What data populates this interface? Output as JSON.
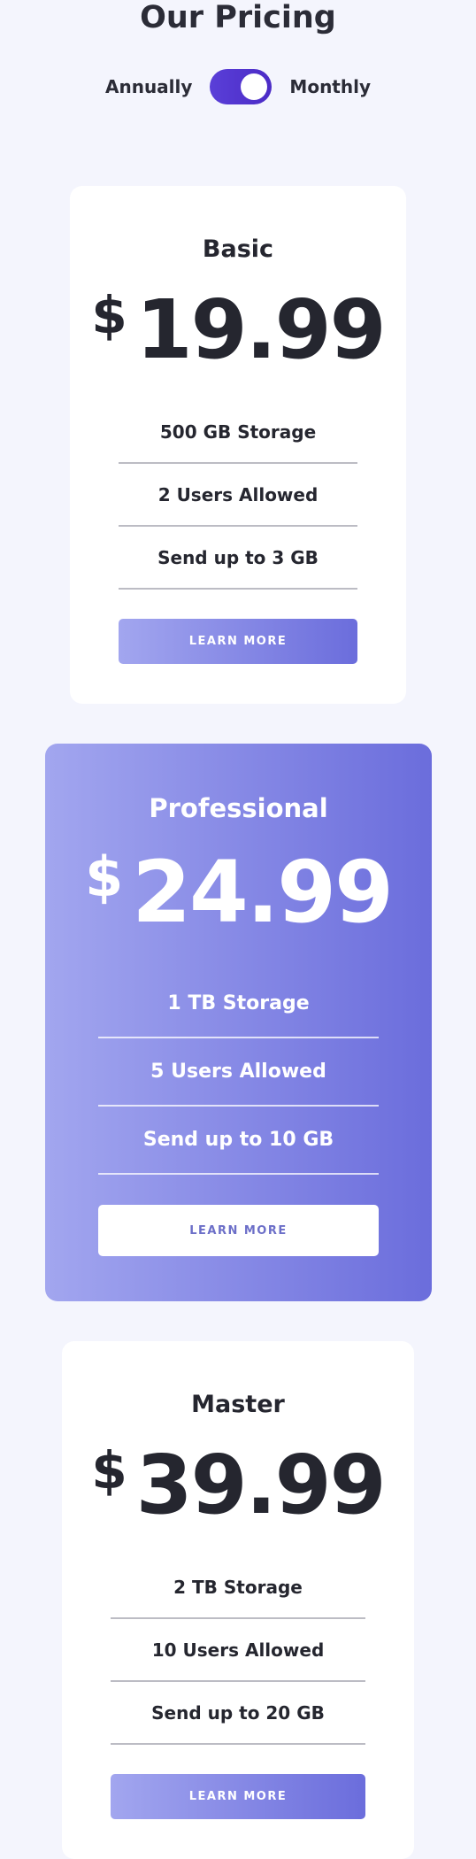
{
  "header": {
    "title": "Our Pricing",
    "toggle": {
      "left_label": "Annually",
      "right_label": "Monthly",
      "state": "monthly"
    }
  },
  "plans": [
    {
      "name": "Basic",
      "currency": "$",
      "price": "19.99",
      "features": [
        "500 GB Storage",
        "2 Users Allowed",
        "Send up to 3 GB"
      ],
      "button_label": "LEARN MORE"
    },
    {
      "name": "Professional",
      "currency": "$",
      "price": "24.99",
      "features": [
        "1 TB Storage",
        "5 Users Allowed",
        "Send up to 10 GB"
      ],
      "button_label": "LEARN MORE"
    },
    {
      "name": "Master",
      "currency": "$",
      "price": "39.99",
      "features": [
        "2 TB Storage",
        "10 Users Allowed",
        "Send up to 20 GB"
      ],
      "button_label": "LEARN MORE"
    }
  ],
  "colors": {
    "background": "#f4f5fd",
    "accent_gradient_start": "#a2a6ef",
    "accent_gradient_end": "#6b6ddc",
    "toggle": "#5a3fd8",
    "text_dark": "#25262f"
  }
}
